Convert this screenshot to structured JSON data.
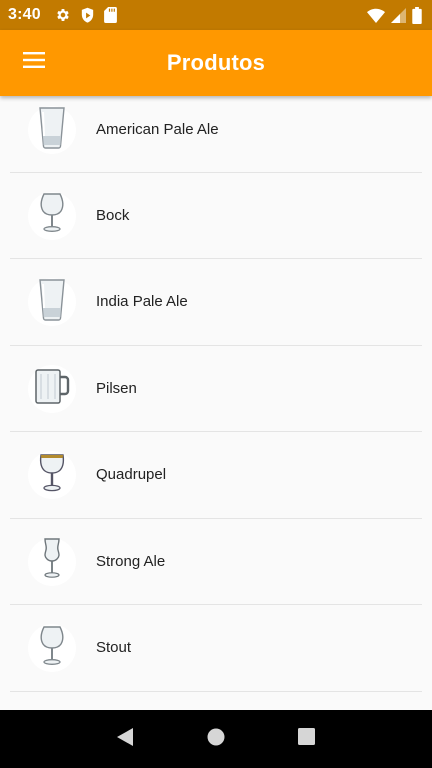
{
  "status_bar": {
    "time": "3:40",
    "left_icons": [
      "gear-icon",
      "shield-play-icon",
      "sd-card-icon"
    ],
    "right_icons": [
      "wifi-icon",
      "cell-signal-icon",
      "battery-icon"
    ]
  },
  "app_bar": {
    "title": "Produtos",
    "color": "#ff9800",
    "menu_icon": "hamburger-menu-icon"
  },
  "products": [
    {
      "name": "American Pale Ale",
      "icon": "pint-glass-icon"
    },
    {
      "name": "Bock",
      "icon": "snifter-glass-icon"
    },
    {
      "name": "India Pale Ale",
      "icon": "pint-glass-icon"
    },
    {
      "name": "Pilsen",
      "icon": "beer-mug-icon"
    },
    {
      "name": "Quadrupel",
      "icon": "chalice-glass-icon"
    },
    {
      "name": "Strong Ale",
      "icon": "tulip-glass-icon"
    },
    {
      "name": "Stout",
      "icon": "snifter-glass-icon"
    }
  ],
  "nav_bar": {
    "buttons": [
      "back-icon",
      "home-icon",
      "recents-icon"
    ]
  }
}
